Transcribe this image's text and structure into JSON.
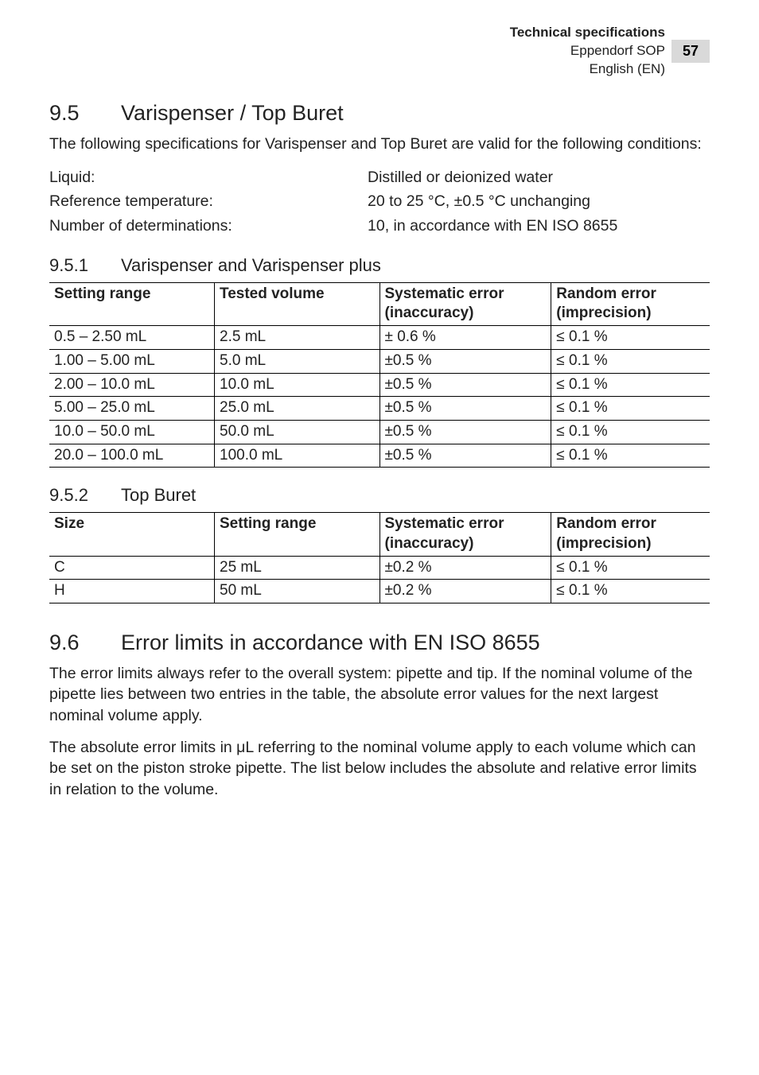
{
  "header": {
    "line1": "Technical specifications",
    "line2": "Eppendorf SOP",
    "line3": "English (EN)",
    "page_no": "57"
  },
  "sec95": {
    "num": "9.5",
    "title": "Varispenser / Top Buret",
    "intro": "The following specifications for Varispenser and Top Buret are valid for the following conditions:",
    "conds": [
      {
        "label": "Liquid:",
        "value": "Distilled or deionized water"
      },
      {
        "label": "Reference temperature:",
        "value": "20 to 25 °C, ±0.5 °C unchanging"
      },
      {
        "label": "Number of determinations:",
        "value": "10, in accordance with EN ISO 8655"
      }
    ]
  },
  "sec951": {
    "num": "9.5.1",
    "title": "Varispenser and Varispenser plus",
    "headers": {
      "c1": "Setting range",
      "c2": "Tested volume",
      "c3a": "Systematic error",
      "c3b": "(inaccuracy)",
      "c4a": "Random error",
      "c4b": "(imprecision)"
    },
    "rows": [
      {
        "range": "0.5 – 2.50 mL",
        "vol": "2.5 mL",
        "sys": "± 0.6 %",
        "rand": "≤ 0.1 %"
      },
      {
        "range": "1.00 – 5.00 mL",
        "vol": "5.0 mL",
        "sys": "±0.5 %",
        "rand": "≤ 0.1 %"
      },
      {
        "range": "2.00 – 10.0 mL",
        "vol": "10.0 mL",
        "sys": "±0.5 %",
        "rand": "≤ 0.1 %"
      },
      {
        "range": "5.00 – 25.0 mL",
        "vol": "25.0 mL",
        "sys": "±0.5 %",
        "rand": "≤ 0.1 %"
      },
      {
        "range": "10.0 – 50.0 mL",
        "vol": "50.0 mL",
        "sys": "±0.5 %",
        "rand": "≤ 0.1 %"
      },
      {
        "range": "20.0 – 100.0 mL",
        "vol": "100.0 mL",
        "sys": "±0.5 %",
        "rand": "≤ 0.1 %"
      }
    ]
  },
  "sec952": {
    "num": "9.5.2",
    "title": "Top Buret",
    "headers": {
      "c1": "Size",
      "c2": "Setting range",
      "c3a": "Systematic error",
      "c3b": "(inaccuracy)",
      "c4a": "Random error",
      "c4b": "(imprecision)"
    },
    "rows": [
      {
        "size": "C",
        "range": "25 mL",
        "sys": "±0.2 %",
        "rand": "≤ 0.1 %"
      },
      {
        "size": "H",
        "range": "50 mL",
        "sys": "±0.2 %",
        "rand": "≤ 0.1 %"
      }
    ]
  },
  "sec96": {
    "num": "9.6",
    "title": "Error limits in accordance with EN ISO 8655",
    "p1": "The error limits always refer to the overall system: pipette and tip. If the nominal volume of the pipette lies between two entries in the table, the absolute error values for the next largest nominal volume apply.",
    "p2": "The absolute error limits in μL referring to the nominal volume apply to each volume which can be set on the piston stroke pipette. The list below includes the absolute and relative error limits in relation to the volume."
  }
}
